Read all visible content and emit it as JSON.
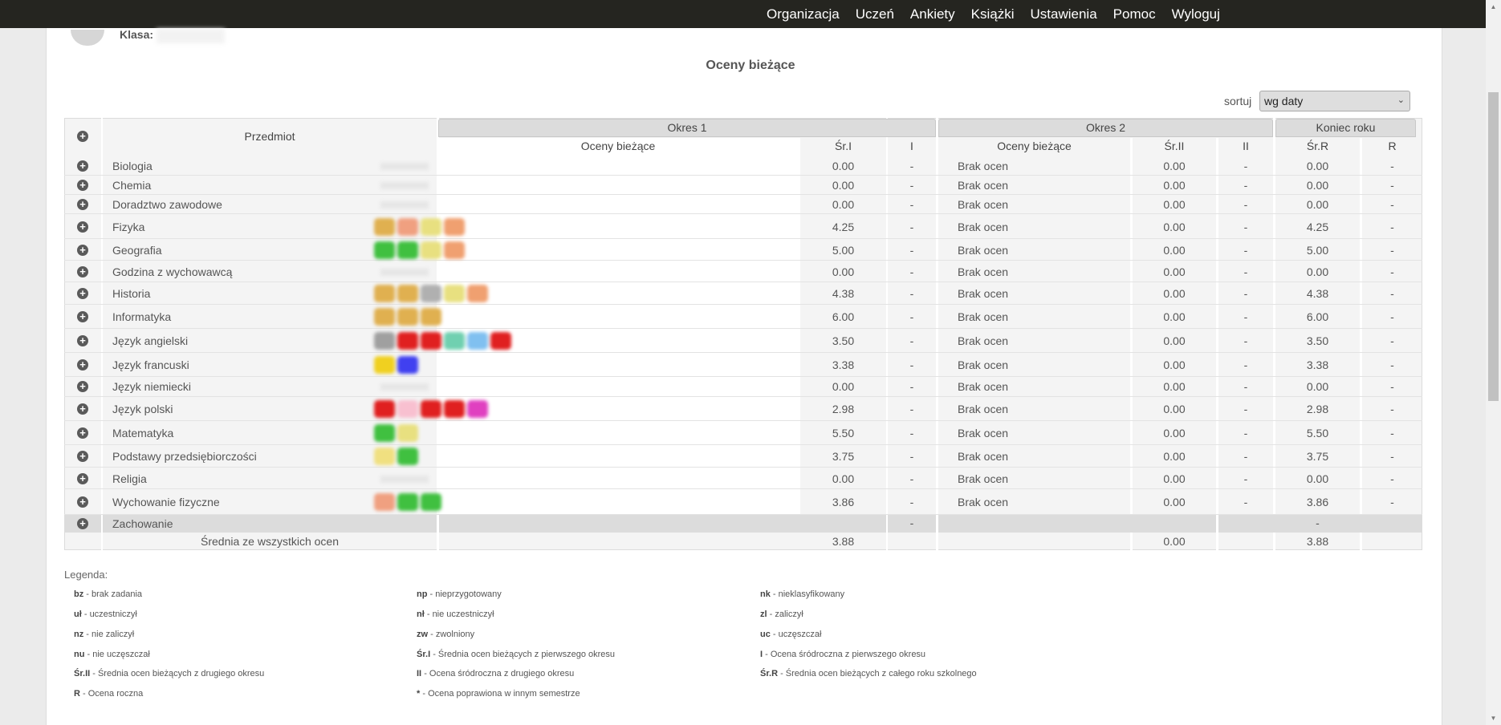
{
  "nav": [
    "Organizacja",
    "Uczeń",
    "Ankiety",
    "Książki",
    "Ustawienia",
    "Pomoc",
    "Wyloguj"
  ],
  "student": {
    "class_label": "Klasa:"
  },
  "title": "Oceny bieżące",
  "sort": {
    "label": "sortuj",
    "value": "wg daty"
  },
  "table": {
    "col_subject": "Przedmiot",
    "okres1": "Okres 1",
    "okres2": "Okres 2",
    "koniec": "Koniec roku",
    "sub": [
      "Oceny bieżące",
      "Śr.I",
      "I",
      "Oceny bieżące",
      "Śr.II",
      "II",
      "Śr.R",
      "R"
    ],
    "rows": [
      {
        "subject": "Biologia",
        "sr1": "0.00",
        "i": "-",
        "o2": "Brak ocen",
        "sr2": "0.00",
        "ii": "-",
        "srr": "0.00",
        "r": "-",
        "marks": []
      },
      {
        "subject": "Chemia",
        "sr1": "0.00",
        "i": "-",
        "o2": "Brak ocen",
        "sr2": "0.00",
        "ii": "-",
        "srr": "0.00",
        "r": "-",
        "marks": []
      },
      {
        "subject": "Doradztwo zawodowe",
        "sr1": "0.00",
        "i": "-",
        "o2": "Brak ocen",
        "sr2": "0.00",
        "ii": "-",
        "srr": "0.00",
        "r": "-",
        "marks": []
      },
      {
        "subject": "Fizyka",
        "sr1": "4.25",
        "i": "-",
        "o2": "Brak ocen",
        "sr2": "0.00",
        "ii": "-",
        "srr": "4.25",
        "r": "-",
        "marks": [
          "#e0b050",
          "#f0a080",
          "#e8e080",
          "#f0a070"
        ]
      },
      {
        "subject": "Geografia",
        "sr1": "5.00",
        "i": "-",
        "o2": "Brak ocen",
        "sr2": "0.00",
        "ii": "-",
        "srr": "5.00",
        "r": "-",
        "marks": [
          "#40c040",
          "#40c040",
          "#e8e080",
          "#f0a070"
        ]
      },
      {
        "subject": "Godzina z wychowawcą",
        "sr1": "0.00",
        "i": "-",
        "o2": "Brak ocen",
        "sr2": "0.00",
        "ii": "-",
        "srr": "0.00",
        "r": "-",
        "marks": []
      },
      {
        "subject": "Historia",
        "sr1": "4.38",
        "i": "-",
        "o2": "Brak ocen",
        "sr2": "0.00",
        "ii": "-",
        "srr": "4.38",
        "r": "-",
        "marks": [
          "#e0b050",
          "#e0b050",
          "#b0b0b0",
          "#e8e080",
          "#f0a070"
        ]
      },
      {
        "subject": "Informatyka",
        "sr1": "6.00",
        "i": "-",
        "o2": "Brak ocen",
        "sr2": "0.00",
        "ii": "-",
        "srr": "6.00",
        "r": "-",
        "marks": [
          "#e0b050",
          "#e0b050",
          "#e0b050"
        ]
      },
      {
        "subject": "Język angielski",
        "sr1": "3.50",
        "i": "-",
        "o2": "Brak ocen",
        "sr2": "0.00",
        "ii": "-",
        "srr": "3.50",
        "r": "-",
        "marks": [
          "#a0a0a0",
          "#e02020",
          "#e02020",
          "#70d0b0",
          "#80c0f0",
          "#e02020"
        ]
      },
      {
        "subject": "Język francuski",
        "sr1": "3.38",
        "i": "-",
        "o2": "Brak ocen",
        "sr2": "0.00",
        "ii": "-",
        "srr": "3.38",
        "r": "-",
        "marks": [
          "#f0d020",
          "#4040f0"
        ]
      },
      {
        "subject": "Język niemiecki",
        "sr1": "0.00",
        "i": "-",
        "o2": "Brak ocen",
        "sr2": "0.00",
        "ii": "-",
        "srr": "0.00",
        "r": "-",
        "marks": []
      },
      {
        "subject": "Język polski",
        "sr1": "2.98",
        "i": "-",
        "o2": "Brak ocen",
        "sr2": "0.00",
        "ii": "-",
        "srr": "2.98",
        "r": "-",
        "marks": [
          "#e02020",
          "#f8c0d0",
          "#e02020",
          "#e02020",
          "#e040c0"
        ]
      },
      {
        "subject": "Matematyka",
        "sr1": "5.50",
        "i": "-",
        "o2": "Brak ocen",
        "sr2": "0.00",
        "ii": "-",
        "srr": "5.50",
        "r": "-",
        "marks": [
          "#40c040",
          "#e8e080"
        ]
      },
      {
        "subject": "Podstawy przedsiębiorczości",
        "sr1": "3.75",
        "i": "-",
        "o2": "Brak ocen",
        "sr2": "0.00",
        "ii": "-",
        "srr": "3.75",
        "r": "-",
        "marks": [
          "#f0e080",
          "#40c040"
        ]
      },
      {
        "subject": "Religia",
        "sr1": "0.00",
        "i": "-",
        "o2": "Brak ocen",
        "sr2": "0.00",
        "ii": "-",
        "srr": "0.00",
        "r": "-",
        "marks": []
      },
      {
        "subject": "Wychowanie fizyczne",
        "sr1": "3.86",
        "i": "-",
        "o2": "Brak ocen",
        "sr2": "0.00",
        "ii": "-",
        "srr": "3.86",
        "r": "-",
        "marks": [
          "#f0a080",
          "#40c040",
          "#40c040"
        ]
      }
    ],
    "behavior": {
      "subject": "Zachowanie",
      "i": "-",
      "srr": "-"
    },
    "summary": {
      "label": "Średnia ze wszystkich ocen",
      "sr1": "3.88",
      "sr2": "0.00",
      "srr": "3.88"
    }
  },
  "legend": {
    "title": "Legenda:",
    "items": [
      [
        "bz",
        "- brak zadania"
      ],
      [
        "np",
        "- nieprzygotowany"
      ],
      [
        "nk",
        "- nieklasyfikowany"
      ],
      [
        "uł",
        "- uczestniczył"
      ],
      [
        "nł",
        "- nie uczestniczył"
      ],
      [
        "zl",
        "- zaliczył"
      ],
      [
        "nz",
        "- nie zaliczył"
      ],
      [
        "zw",
        "- zwolniony"
      ],
      [
        "uc",
        "- uczęszczał"
      ],
      [
        "nu",
        "- nie uczęszczał"
      ],
      [
        "Śr.I",
        "- Średnia ocen bieżących z pierwszego okresu"
      ],
      [
        "I",
        "- Ocena śródroczna z pierwszego okresu"
      ],
      [
        "Śr.II",
        "- Średnia ocen bieżących z drugiego okresu"
      ],
      [
        "II",
        "- Ocena śródroczna z drugiego okresu"
      ],
      [
        "Śr.R",
        "- Średnia ocen bieżących z całego roku szkolnego"
      ],
      [
        "R",
        "- Ocena roczna"
      ],
      [
        "*",
        "- Ocena poprawiona w innym semestrze"
      ]
    ]
  }
}
